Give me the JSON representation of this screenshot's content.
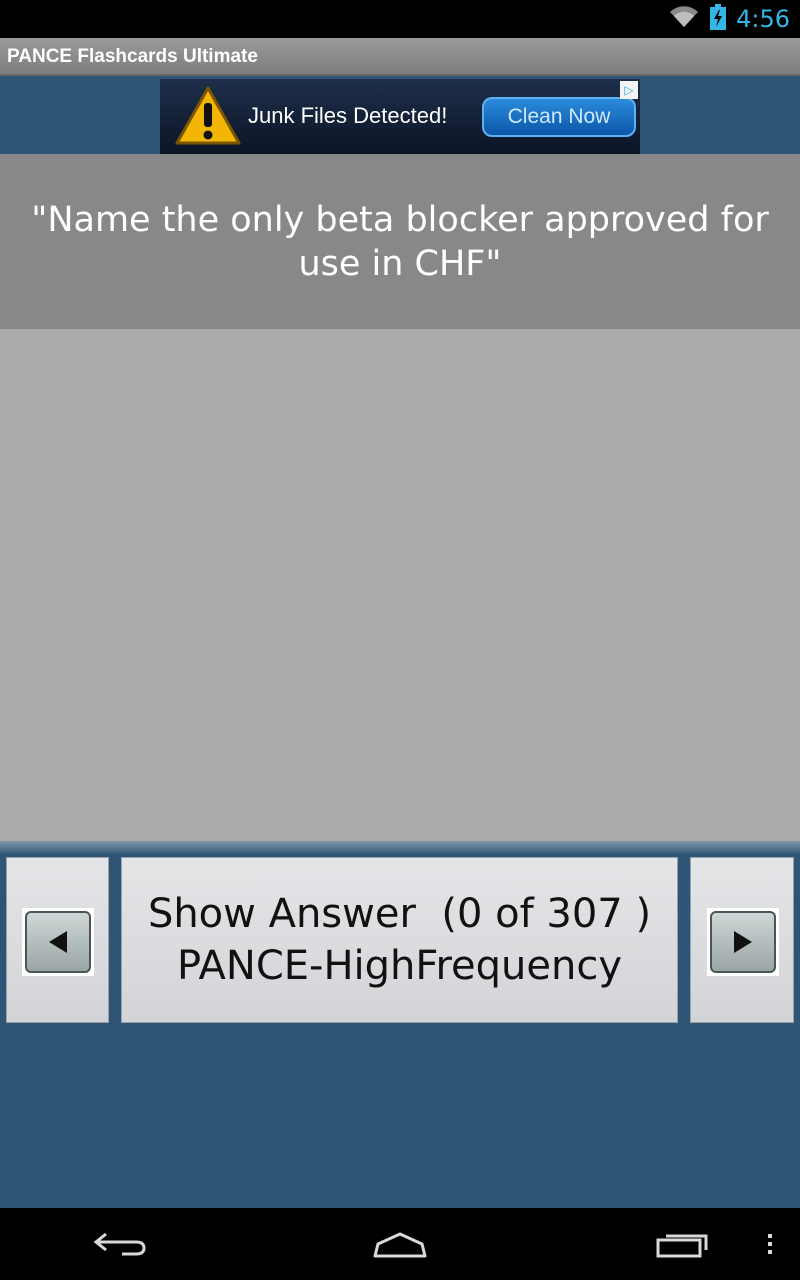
{
  "status_bar": {
    "time": "4:56",
    "icons": [
      "wifi-icon",
      "battery-charging-icon"
    ]
  },
  "app": {
    "title": "PANCE Flashcards Ultimate"
  },
  "ad": {
    "icon": "warning-icon",
    "text": "Junk Files Detected!",
    "button_label": "Clean Now",
    "choice_icon": "ad-choices-icon"
  },
  "card": {
    "question": "\"Name the only beta blocker approved for use in CHF\""
  },
  "controls": {
    "prev_icon": "arrow-left-icon",
    "next_icon": "arrow-right-icon",
    "answer_line1": "Show Answer  (0 of 307 )",
    "answer_line2": "PANCE-HighFrequency"
  },
  "system_nav": {
    "icons": [
      "back-icon",
      "home-icon",
      "recent-apps-icon",
      "overflow-menu-icon"
    ]
  },
  "colors": {
    "accent": "#33b5e5",
    "background": "#2e5575",
    "question_bg": "#888888",
    "card_bg": "#aaaaaa"
  }
}
